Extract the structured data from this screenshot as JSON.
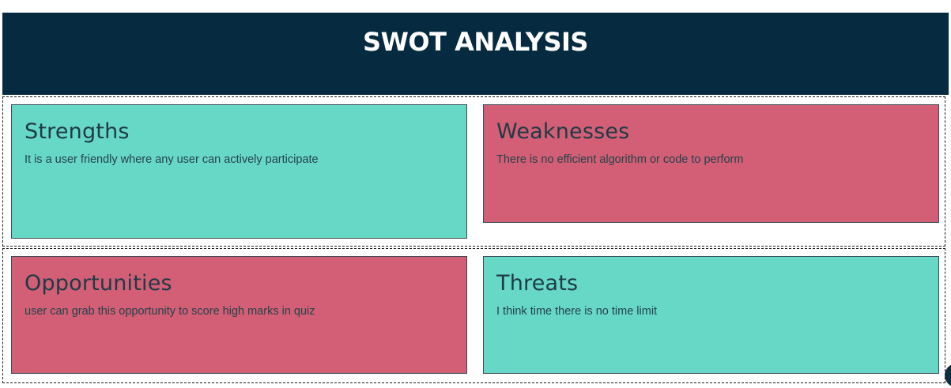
{
  "header": {
    "title": "SWOT ANALYSIS"
  },
  "quadrants": {
    "strengths": {
      "title": "Strengths",
      "text": "It is a user friendly where any user can actively participate"
    },
    "weaknesses": {
      "title": "Weaknesses",
      "text": "There is no efficient algorithm or code to perform"
    },
    "opportunities": {
      "title": "Opportunities",
      "text": "user can grab this opportunity to score high marks in quiz"
    },
    "threats": {
      "title": "Threats",
      "text": "I think time there is no time limit"
    }
  },
  "colors": {
    "header_bg": "#062a3f",
    "teal": "#67d8c6",
    "rose": "#d25f75",
    "text": "#1f3a47"
  }
}
